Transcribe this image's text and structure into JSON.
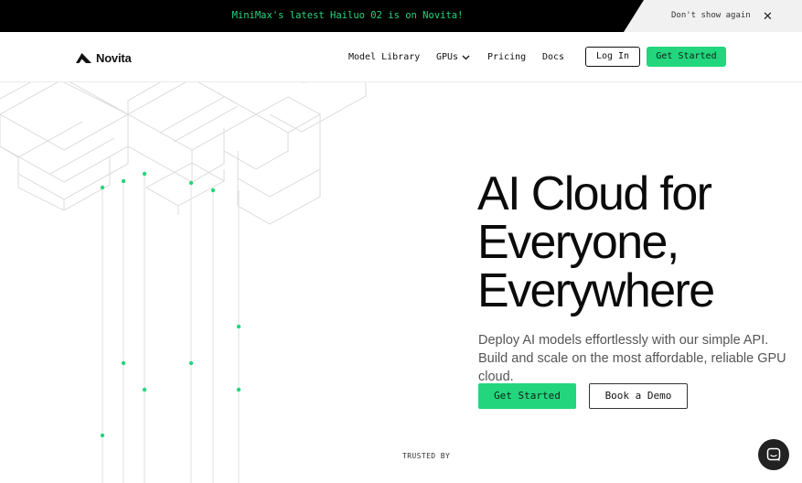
{
  "announcement": {
    "text": "MiniMax's latest Hailuo 02 is on Novita!",
    "dismiss_label": "Don't show again",
    "close_glyph": "✕"
  },
  "nav": {
    "brand": "Novita",
    "links": {
      "model_library": "Model Library",
      "gpus": "GPUs",
      "pricing": "Pricing",
      "docs": "Docs"
    },
    "login_label": "Log In",
    "get_started_label": "Get Started"
  },
  "hero": {
    "title_lines": [
      "AI Cloud for",
      "Everyone,",
      "Everywhere"
    ],
    "subtitle": "Deploy AI models effortlessly with our simple API. Build and scale on the most affordable, reliable GPU cloud.",
    "primary_cta": "Get Started",
    "secondary_cta": "Book a Demo",
    "trusted_label": "TRUSTED BY"
  },
  "icons": {
    "logo": "novita-logo-icon",
    "gpus_dropdown": "chevron-down-icon",
    "chat": "chat-icon",
    "close": "close-icon"
  },
  "colors": {
    "accent": "#23d67d",
    "announcement_bg": "#000000",
    "text": "#111111"
  }
}
